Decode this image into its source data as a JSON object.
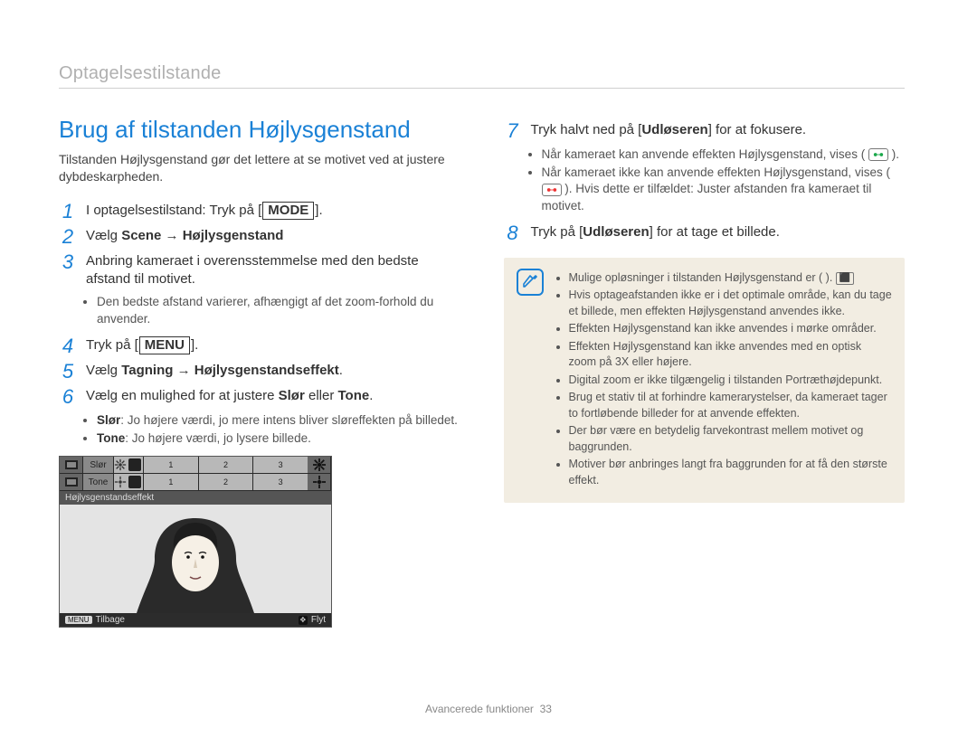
{
  "breadcrumb": "Optagelsestilstande",
  "heading": "Brug af tilstanden Højlysgenstand",
  "intro": "Tilstanden Højlysgenstand gør det lettere at se motivet ved at justere dybdeskarpheden.",
  "steps": {
    "s1": {
      "num": "1",
      "prefix": "I optagelsestilstand: Tryk på ",
      "button": "MODE",
      "suffix": "."
    },
    "s2": {
      "num": "2",
      "text_a": "Vælg ",
      "bold": "Scene → Højlysgenstand"
    },
    "s3": {
      "num": "3",
      "text": "Anbring kameraet i overensstemmelse med den bedste afstand til motivet.",
      "bullets": [
        "Den bedste afstand varierer, afhængigt af det zoom-forhold du anvender."
      ]
    },
    "s4": {
      "num": "4",
      "prefix": "Tryk på ",
      "button": "MENU",
      "suffix": "."
    },
    "s5": {
      "num": "5",
      "text_a": "Vælg ",
      "bold": "Tagning → Højlysgenstandseffekt",
      "text_b": "."
    },
    "s6": {
      "num": "6",
      "text_a": "Vælg en mulighed for at justere ",
      "bold1": "Slør",
      "mid": " eller ",
      "bold2": "Tone",
      "text_b": ".",
      "bullets": [
        {
          "b": "Slør",
          "t": ": Jo højere værdi, jo mere intens bliver sløreffekten på billedet."
        },
        {
          "b": "Tone",
          "t": ": Jo højere værdi, jo lysere billede."
        }
      ]
    },
    "s7": {
      "num": "7",
      "text_a": "Tryk halvt ned på [",
      "bold": "Udløseren",
      "text_b": "] for at fokusere.",
      "bullets": [
        "Når kameraet kan anvende effekten Højlysgenstand, vises (",
        ").",
        "Når kameraet ikke kan anvende effekten Højlysgenstand, vises (",
        "). Hvis dette er tilfældet: Juster afstanden fra kameraet til motivet."
      ]
    },
    "s8": {
      "num": "8",
      "text_a": "Tryk på [",
      "bold": "Udløseren",
      "text_b": "] for at tage et billede."
    }
  },
  "notes": [
    "Mulige opløsninger i tilstanden Højlysgenstand er (   ).",
    "Hvis optageafstanden ikke er i det optimale område, kan du tage et billede, men effekten Højlysgenstand anvendes ikke.",
    "Effekten Højlysgenstand kan ikke anvendes i mørke områder.",
    "Effekten Højlysgenstand kan ikke anvendes med en optisk zoom på 3X eller højere.",
    "Digital zoom er ikke tilgængelig i tilstanden Portræthøjdepunkt.",
    "Brug et stativ til at forhindre kamerarystelser, da kameraet tager to fortløbende billeder for at anvende effekten.",
    "Der bør være en betydelig farvekontrast mellem motivet og baggrunden.",
    "Motiver bør anbringes langt fra baggrunden for at få den største effekt."
  ],
  "lcd": {
    "row1_label": "Slør",
    "row2_label": "Tone",
    "seg1": "1",
    "seg2": "2",
    "seg3": "3",
    "overlay": "Højlysgenstandseffekt",
    "back_btn": "MENU",
    "back_label": "Tilbage",
    "move_label": "Flyt"
  },
  "note_chip": "⬛",
  "footer": {
    "label": "Avancerede funktioner",
    "page": "33"
  }
}
